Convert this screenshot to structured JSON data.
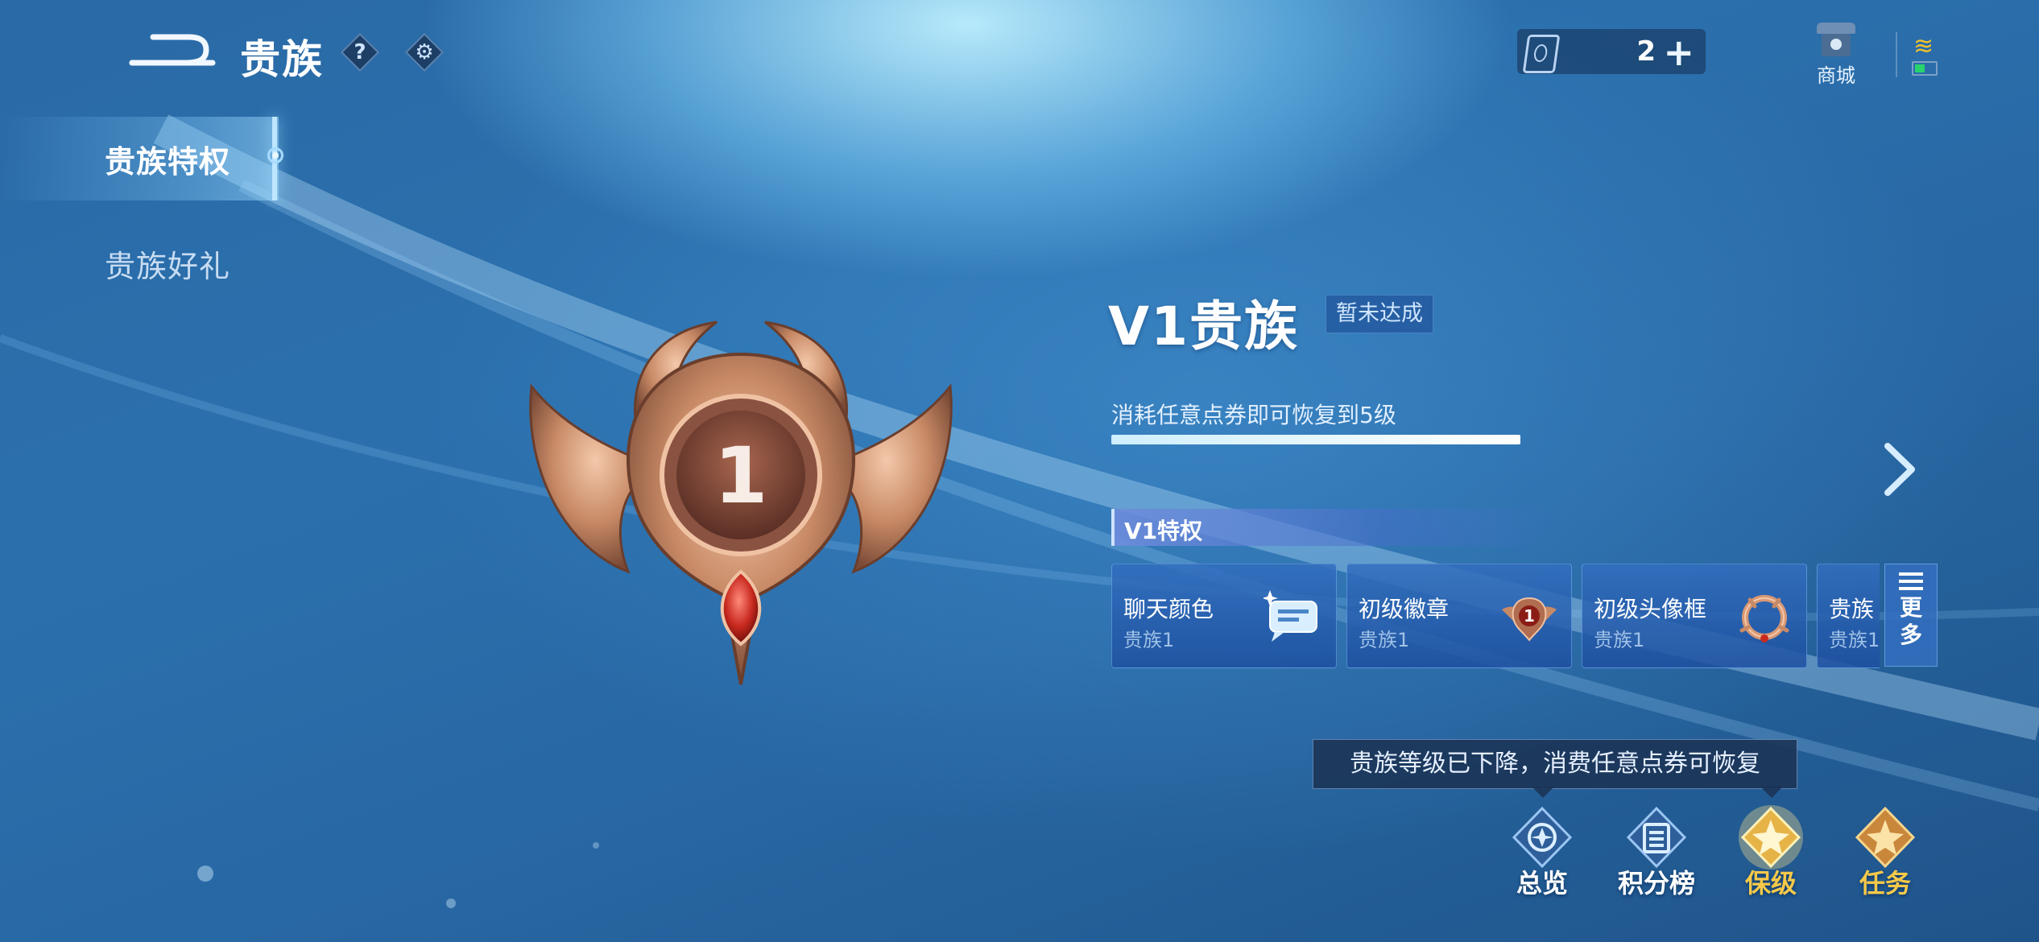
{
  "header": {
    "title": "贵族",
    "help_icon": "question-icon",
    "settings_icon": "gear-icon",
    "currency_amount": "2",
    "currency_add": "+",
    "shop_label": "商城"
  },
  "sidebar": {
    "items": [
      {
        "label": "贵族特权",
        "active": true
      },
      {
        "label": "贵族好礼",
        "active": false
      }
    ]
  },
  "badge": {
    "level": "1"
  },
  "tier": {
    "title": "V1贵族",
    "status_tag": "暂未达成",
    "description": "消耗任意点券即可恢复到5级",
    "progress_fraction": 1.0
  },
  "privileges": {
    "heading": "V1特权",
    "cards": [
      {
        "name": "聊天颜色",
        "sub": "贵族1",
        "icon": "chat-bubble-icon"
      },
      {
        "name": "初级徽章",
        "sub": "贵族1",
        "icon": "badge-icon"
      },
      {
        "name": "初级头像框",
        "sub": "贵族1",
        "icon": "avatar-frame-icon"
      },
      {
        "name": "贵族",
        "sub": "贵族1",
        "icon": ""
      }
    ],
    "more_label_1": "更",
    "more_label_2": "多"
  },
  "tooltip": {
    "text": "贵族等级已下降，消费任意点券可恢复"
  },
  "bottom_nav": [
    {
      "label": "总览",
      "color": "#ffffff"
    },
    {
      "label": "积分榜",
      "color": "#ffffff"
    },
    {
      "label": "保级",
      "color": "#f6c94a"
    },
    {
      "label": "任务",
      "color": "#f6c94a"
    }
  ],
  "colors": {
    "accent": "#f6c94a",
    "bronze": "#c88a66",
    "gem": "#c8291f"
  }
}
